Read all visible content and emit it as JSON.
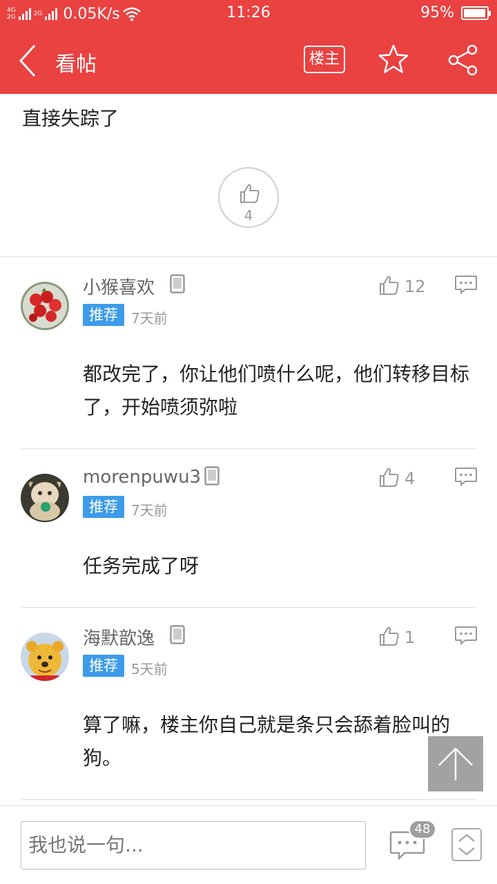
{
  "status_bar": {
    "network_top": "4G",
    "network_bottom": "2G",
    "network2": "2G",
    "speed": "0.05K/s",
    "time": "11:26",
    "battery": "95%"
  },
  "nav": {
    "title": "看帖",
    "owner_label": "楼主"
  },
  "post": {
    "tail_text": "直接失踪了",
    "like_count": "4"
  },
  "comments": [
    {
      "username": "小猴喜欢",
      "badge": "推荐",
      "time": "7天前",
      "likes": "12",
      "text": "都改完了，你让他们喷什么呢，他们转移目标了，开始喷须弥啦"
    },
    {
      "username": "morenpuwu3",
      "badge": "推荐",
      "time": "7天前",
      "likes": "4",
      "text": "任务完成了呀"
    },
    {
      "username": "海默歆逸",
      "badge": "推荐",
      "time": "5天前",
      "likes": "1",
      "text": "算了嘛，楼主你自己就是条只会舔着脸叫的狗。"
    }
  ],
  "bottom": {
    "input_placeholder": "我也说一句...",
    "comment_count": "48"
  },
  "colors": {
    "header_red": "#ea4141",
    "badge_blue": "#3d9be9"
  }
}
